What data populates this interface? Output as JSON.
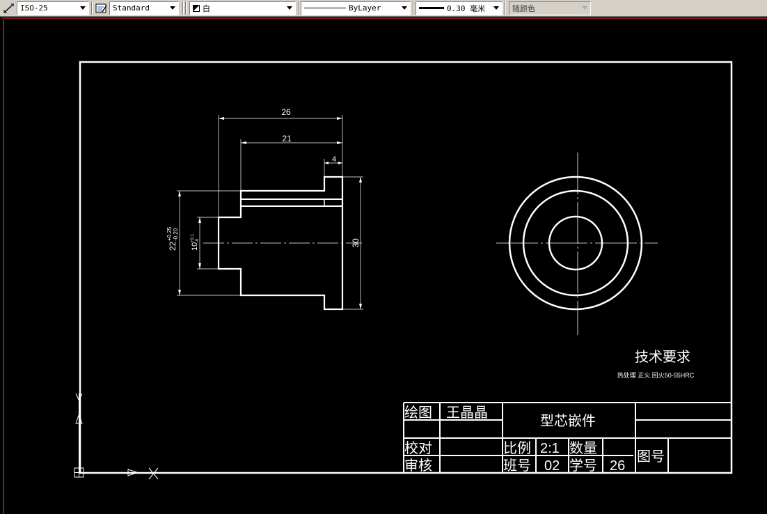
{
  "toolbar": {
    "dimstyle": "ISO-25",
    "textstyle": "Standard",
    "color": "白",
    "linetype": "ByLayer",
    "lineweight": "0.30 毫米",
    "plotstyle": "随颜色"
  },
  "drawing": {
    "dim_26": "26",
    "dim_21": "21",
    "dim_4": "4",
    "dim_30": "30",
    "dim_22": "22",
    "dim_22_upper": "+0.25",
    "dim_22_lower": "-0.20",
    "dim_10": "10",
    "dim_10_upper": "+0.1",
    "dim_10_lower": "-0",
    "tech_title": "技术要求",
    "tech_text": "热处理  正火  回火50-55HRC"
  },
  "title_block": {
    "drawn_label": "绘图",
    "drawn_value": "王晶晶",
    "part_name": "型芯嵌件",
    "check_label": "校对",
    "approve_label": "审核",
    "scale_label": "比例",
    "scale_value": "2:1",
    "qty_label": "数量",
    "class_label": "班号",
    "class_value": "02",
    "student_label": "学号",
    "student_value": "26",
    "drawing_no_label": "图号"
  },
  "colors": {
    "toolbar_bg": "#d4d0c8",
    "canvas_bg": "#000000",
    "lines": "#ffffff",
    "border_red": "#8b1a1a"
  }
}
